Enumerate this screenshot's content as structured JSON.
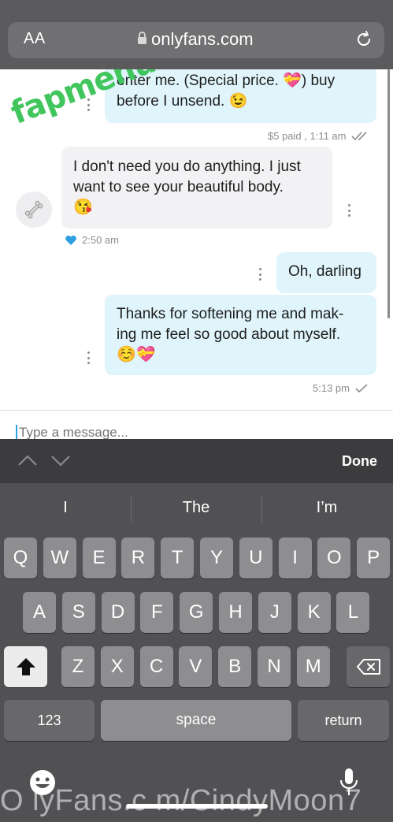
{
  "browser": {
    "text_size_label": "AA",
    "url": "onlyfans.com"
  },
  "watermark": "fapmenu.com",
  "messages": [
    {
      "direction": "out",
      "lines": [
        "enter me. (Special price. 💝) buy",
        "before I unsend. 😉"
      ],
      "meta": "$5 paid , 1:11 am"
    },
    {
      "direction": "in",
      "lines": [
        "I don't need you do anything. I just",
        "want to see your beautiful body.",
        "😘"
      ],
      "meta": "2:50 am"
    },
    {
      "direction": "out",
      "lines": [
        "Oh, darling"
      ]
    },
    {
      "direction": "out",
      "lines": [
        "Thanks for softening me and mak-",
        "ing me feel so good about myself.",
        "☺️💝"
      ],
      "meta": "5:13 pm"
    }
  ],
  "composer": {
    "placeholder": "Type a message..."
  },
  "keyboard": {
    "done_label": "Done",
    "suggestions": [
      "I",
      "The",
      "I’m"
    ],
    "row1": [
      "Q",
      "W",
      "E",
      "R",
      "T",
      "Y",
      "U",
      "I",
      "O",
      "P"
    ],
    "row2": [
      "A",
      "S",
      "D",
      "F",
      "G",
      "H",
      "J",
      "K",
      "L"
    ],
    "row3": [
      "Z",
      "X",
      "C",
      "V",
      "B",
      "N",
      "M"
    ],
    "numbers_label": "123",
    "space_label": "space",
    "return_label": "return"
  },
  "footer_watermark": "O lyFans.c m/CindyMoon7",
  "colors": {
    "outgoing_bubble": "#dff4fb",
    "incoming_bubble": "#f2f2f4",
    "accent": "#2e9fe0",
    "watermark": "#41c65d"
  }
}
